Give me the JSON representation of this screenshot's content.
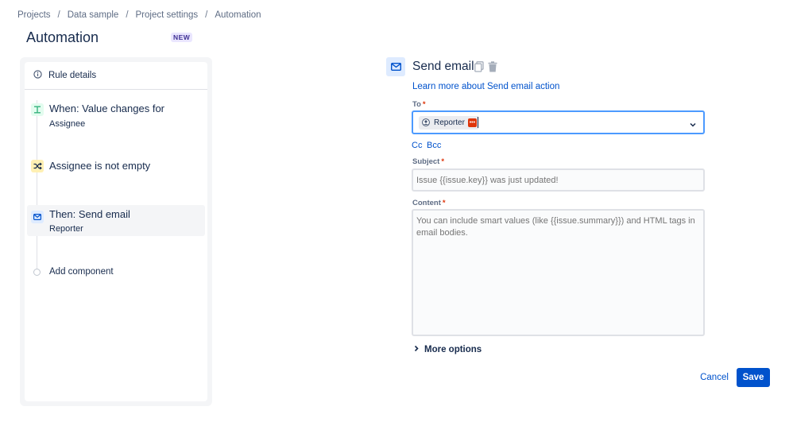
{
  "breadcrumb": {
    "items": [
      "Projects",
      "Data sample",
      "Project settings",
      "Automation"
    ],
    "separator": "/"
  },
  "page": {
    "title": "Automation",
    "badge": "NEW"
  },
  "rule": {
    "details_label": "Rule details",
    "steps": [
      {
        "title": "When: Value changes for",
        "subtitle": "Assignee",
        "icon": "trigger-icon",
        "color": "#36b37e"
      },
      {
        "title": "Assignee is not empty",
        "subtitle": "",
        "icon": "shuffle-icon",
        "color": "#ffab00"
      },
      {
        "title": "Then: Send email",
        "subtitle": "Reporter",
        "icon": "mail-icon",
        "color": "#0052cc"
      }
    ],
    "add_component": "Add component"
  },
  "action": {
    "title": "Send email",
    "learn_more": "Learn more about Send email action",
    "to": {
      "label": "To",
      "chip_label": "Reporter"
    },
    "cc": "Cc",
    "bcc": "Bcc",
    "subject": {
      "label": "Subject",
      "placeholder": "Issue {{issue.key}} was just updated!"
    },
    "content": {
      "label": "Content",
      "placeholder": "You can include smart values (like {{issue.summary}}) and HTML tags in email bodies."
    },
    "more_options": "More options"
  },
  "buttons": {
    "cancel": "Cancel",
    "save": "Save"
  },
  "colors": {
    "primary": "#0052cc",
    "required": "#de350b",
    "focus": "#4c9aff"
  }
}
